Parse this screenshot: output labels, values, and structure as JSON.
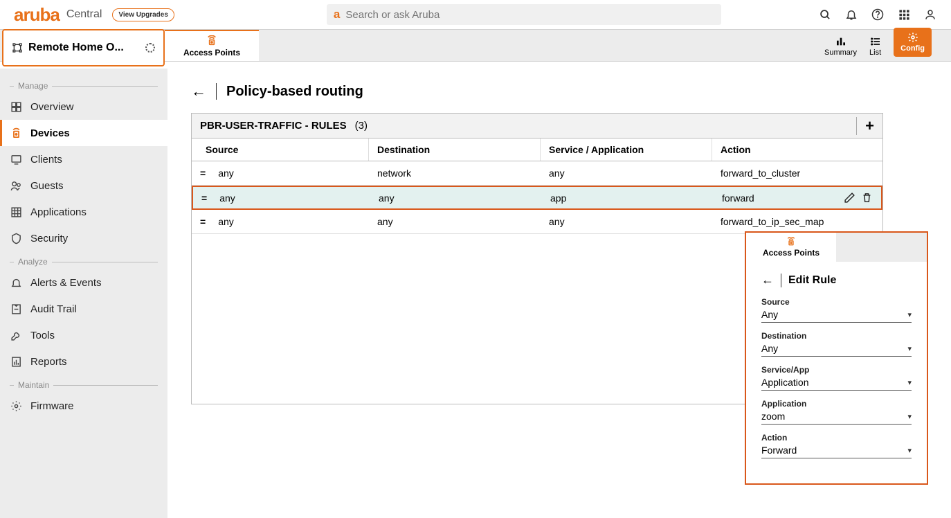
{
  "header": {
    "brand": "aruba",
    "brand_sub": "Central",
    "upgrades_label": "View Upgrades",
    "search_placeholder": "Search or ask Aruba"
  },
  "subheader": {
    "context_label": "Remote Home O...",
    "tab_label": "Access Points",
    "modes": {
      "summary": "Summary",
      "list": "List",
      "config": "Config"
    }
  },
  "sidebar": {
    "sections": {
      "manage": "Manage",
      "analyze": "Analyze",
      "maintain": "Maintain"
    },
    "items": {
      "overview": "Overview",
      "devices": "Devices",
      "clients": "Clients",
      "guests": "Guests",
      "applications": "Applications",
      "security": "Security",
      "alerts": "Alerts & Events",
      "audit": "Audit Trail",
      "tools": "Tools",
      "reports": "Reports",
      "firmware": "Firmware"
    }
  },
  "main": {
    "page_title": "Policy-based routing",
    "table": {
      "title": "PBR-USER-TRAFFIC - RULES",
      "count": "(3)",
      "cols": {
        "source": "Source",
        "destination": "Destination",
        "service": "Service / Application",
        "action": "Action"
      },
      "rows": [
        {
          "source": "any",
          "destination": "network",
          "service": "any",
          "action": "forward_to_cluster"
        },
        {
          "source": "any",
          "destination": "any",
          "service": "app",
          "action": "forward"
        },
        {
          "source": "any",
          "destination": "any",
          "service": "any",
          "action": "forward_to_ip_sec_map"
        }
      ]
    }
  },
  "panel": {
    "tab_label": "Access Points",
    "title": "Edit Rule",
    "fields": [
      {
        "label": "Source",
        "value": "Any"
      },
      {
        "label": "Destination",
        "value": "Any"
      },
      {
        "label": "Service/App",
        "value": "Application"
      },
      {
        "label": "Application",
        "value": "zoom"
      },
      {
        "label": "Action",
        "value": "Forward"
      }
    ]
  }
}
